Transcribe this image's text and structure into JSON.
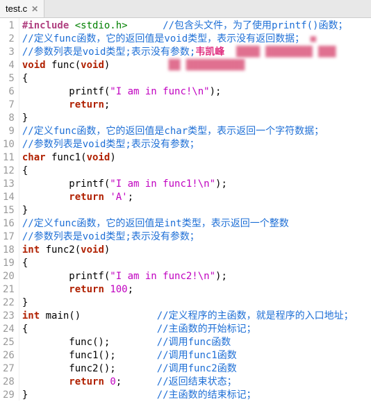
{
  "tab": {
    "filename": "test.c",
    "close": "✕"
  },
  "lines": [
    {
      "n": "1",
      "segs": [
        {
          "t": "#include ",
          "c": "pre"
        },
        {
          "t": "<stdio.h>",
          "c": "inc"
        },
        {
          "t": "      ",
          "c": "p"
        },
        {
          "t": "//包含头文件，为了使用printf()函数；",
          "c": "cmt"
        }
      ]
    },
    {
      "n": "2",
      "segs": [
        {
          "t": "//定义func函数，它的返回值是void类型，表示没有返回数据；",
          "c": "cmt"
        },
        {
          "t": " ",
          "c": "p"
        },
        {
          "t": "■",
          "c": "blur"
        }
      ]
    },
    {
      "n": "3",
      "segs": [
        {
          "t": "//参数列表是void类型;表示没有参数;",
          "c": "cmt"
        },
        {
          "t": "韦凯峰",
          "c": "pink"
        },
        {
          "t": "  ",
          "c": "p"
        },
        {
          "t": "████ ████████ ███",
          "c": "blur"
        }
      ]
    },
    {
      "n": "4",
      "segs": [
        {
          "t": "void",
          "c": "kw2"
        },
        {
          "t": " func(",
          "c": "p"
        },
        {
          "t": "void",
          "c": "kw2"
        },
        {
          "t": ")",
          "c": "p"
        },
        {
          "t": "          ",
          "c": "p"
        },
        {
          "t": "██ ██████████",
          "c": "blur"
        }
      ]
    },
    {
      "n": "5",
      "segs": [
        {
          "t": "{",
          "c": "p"
        }
      ]
    },
    {
      "n": "6",
      "segs": [
        {
          "t": "        printf(",
          "c": "p"
        },
        {
          "t": "\"I am in func!\\n\"",
          "c": "str"
        },
        {
          "t": ");",
          "c": "p"
        }
      ]
    },
    {
      "n": "7",
      "segs": [
        {
          "t": "        ",
          "c": "p"
        },
        {
          "t": "return",
          "c": "kw2"
        },
        {
          "t": ";",
          "c": "p"
        }
      ]
    },
    {
      "n": "8",
      "segs": [
        {
          "t": "}",
          "c": "p"
        }
      ]
    },
    {
      "n": "9",
      "segs": [
        {
          "t": "//定义func函数，它的返回值是char类型，表示返回一个字符数据；",
          "c": "cmt"
        }
      ]
    },
    {
      "n": "10",
      "segs": [
        {
          "t": "//参数列表是void类型;表示没有参数；",
          "c": "cmt"
        }
      ]
    },
    {
      "n": "11",
      "segs": [
        {
          "t": "char",
          "c": "kw2"
        },
        {
          "t": " func1(",
          "c": "p"
        },
        {
          "t": "void",
          "c": "kw2"
        },
        {
          "t": ")",
          "c": "p"
        }
      ]
    },
    {
      "n": "12",
      "segs": [
        {
          "t": "{",
          "c": "p"
        }
      ]
    },
    {
      "n": "13",
      "segs": [
        {
          "t": "        printf(",
          "c": "p"
        },
        {
          "t": "\"I am in func1!\\n\"",
          "c": "str"
        },
        {
          "t": ");",
          "c": "p"
        }
      ]
    },
    {
      "n": "14",
      "segs": [
        {
          "t": "        ",
          "c": "p"
        },
        {
          "t": "return",
          "c": "kw2"
        },
        {
          "t": " ",
          "c": "p"
        },
        {
          "t": "'A'",
          "c": "str"
        },
        {
          "t": ";",
          "c": "p"
        }
      ]
    },
    {
      "n": "15",
      "segs": [
        {
          "t": "}",
          "c": "p"
        }
      ]
    },
    {
      "n": "16",
      "segs": [
        {
          "t": "//定义func函数，它的返回值是int类型，表示返回一个整数",
          "c": "cmt"
        }
      ]
    },
    {
      "n": "17",
      "segs": [
        {
          "t": "//参数列表是void类型;表示没有参数；",
          "c": "cmt"
        }
      ]
    },
    {
      "n": "18",
      "segs": [
        {
          "t": "int",
          "c": "kw2"
        },
        {
          "t": " func2(",
          "c": "p"
        },
        {
          "t": "void",
          "c": "kw2"
        },
        {
          "t": ")",
          "c": "p"
        }
      ]
    },
    {
      "n": "19",
      "segs": [
        {
          "t": "{",
          "c": "p"
        }
      ]
    },
    {
      "n": "20",
      "segs": [
        {
          "t": "        printf(",
          "c": "p"
        },
        {
          "t": "\"I am in func2!\\n\"",
          "c": "str"
        },
        {
          "t": ");",
          "c": "p"
        }
      ]
    },
    {
      "n": "21",
      "segs": [
        {
          "t": "        ",
          "c": "p"
        },
        {
          "t": "return",
          "c": "kw2"
        },
        {
          "t": " ",
          "c": "p"
        },
        {
          "t": "100",
          "c": "num"
        },
        {
          "t": ";",
          "c": "p"
        }
      ]
    },
    {
      "n": "22",
      "segs": [
        {
          "t": "}",
          "c": "p"
        }
      ]
    },
    {
      "n": "23",
      "segs": [
        {
          "t": "int",
          "c": "kw2"
        },
        {
          "t": " main()",
          "c": "p"
        },
        {
          "t": "             ",
          "c": "p"
        },
        {
          "t": "//定义程序的主函数，就是程序的入口地址；",
          "c": "cmt"
        }
      ]
    },
    {
      "n": "24",
      "segs": [
        {
          "t": "{",
          "c": "p"
        },
        {
          "t": "                      ",
          "c": "p"
        },
        {
          "t": "//主函数的开始标记；",
          "c": "cmt"
        }
      ]
    },
    {
      "n": "25",
      "segs": [
        {
          "t": "        func();",
          "c": "p"
        },
        {
          "t": "        ",
          "c": "p"
        },
        {
          "t": "//调用func函数",
          "c": "cmt"
        }
      ]
    },
    {
      "n": "26",
      "segs": [
        {
          "t": "        func1();",
          "c": "p"
        },
        {
          "t": "       ",
          "c": "p"
        },
        {
          "t": "//调用func1函数",
          "c": "cmt"
        }
      ]
    },
    {
      "n": "27",
      "segs": [
        {
          "t": "        func2();",
          "c": "p"
        },
        {
          "t": "       ",
          "c": "p"
        },
        {
          "t": "//调用func2函数",
          "c": "cmt"
        }
      ]
    },
    {
      "n": "28",
      "segs": [
        {
          "t": "        ",
          "c": "p"
        },
        {
          "t": "return",
          "c": "kw2"
        },
        {
          "t": " ",
          "c": "p"
        },
        {
          "t": "0",
          "c": "num"
        },
        {
          "t": ";",
          "c": "p"
        },
        {
          "t": "      ",
          "c": "p"
        },
        {
          "t": "//返回结束状态；",
          "c": "cmt"
        }
      ]
    },
    {
      "n": "29",
      "segs": [
        {
          "t": "}",
          "c": "p"
        },
        {
          "t": "                      ",
          "c": "p"
        },
        {
          "t": "//主函数的结束标记；",
          "c": "cmt"
        }
      ]
    }
  ]
}
